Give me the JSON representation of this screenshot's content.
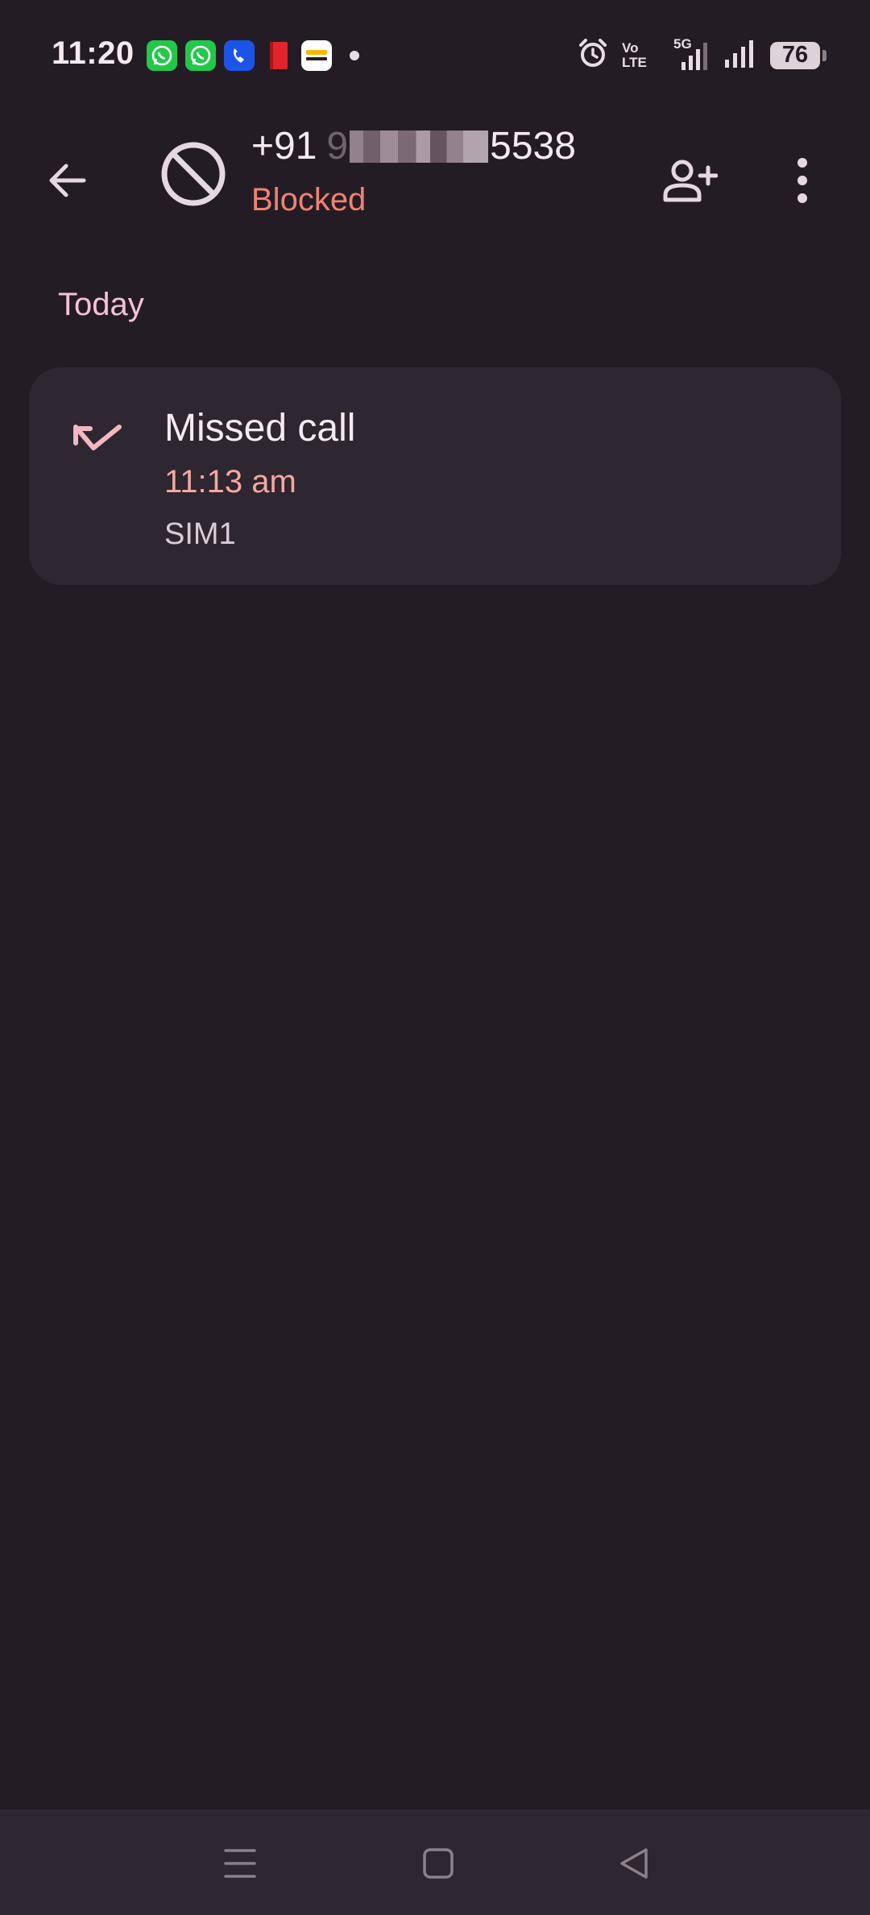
{
  "status_bar": {
    "time": "11:20",
    "notifications": [
      "whatsapp-icon",
      "whatsapp-business-icon",
      "truecaller-icon",
      "red-book-icon",
      "captain-app-icon"
    ],
    "volte_line1": "Vo",
    "volte_line2": "LTE",
    "network": "5G",
    "battery": "76"
  },
  "header": {
    "number_prefix": "+91",
    "number_masked_hint": "9",
    "number_suffix": "5538",
    "status": "Blocked"
  },
  "history": {
    "section_label": "Today",
    "calls": [
      {
        "type": "Missed call",
        "time": "11:13 am",
        "sim": "SIM1"
      }
    ]
  },
  "colors": {
    "background": "#241c25",
    "card": "#2e2630",
    "blocked_red": "#f08272",
    "accent_pink": "#f2c2d8",
    "time_salmon": "#f4a8a0"
  }
}
